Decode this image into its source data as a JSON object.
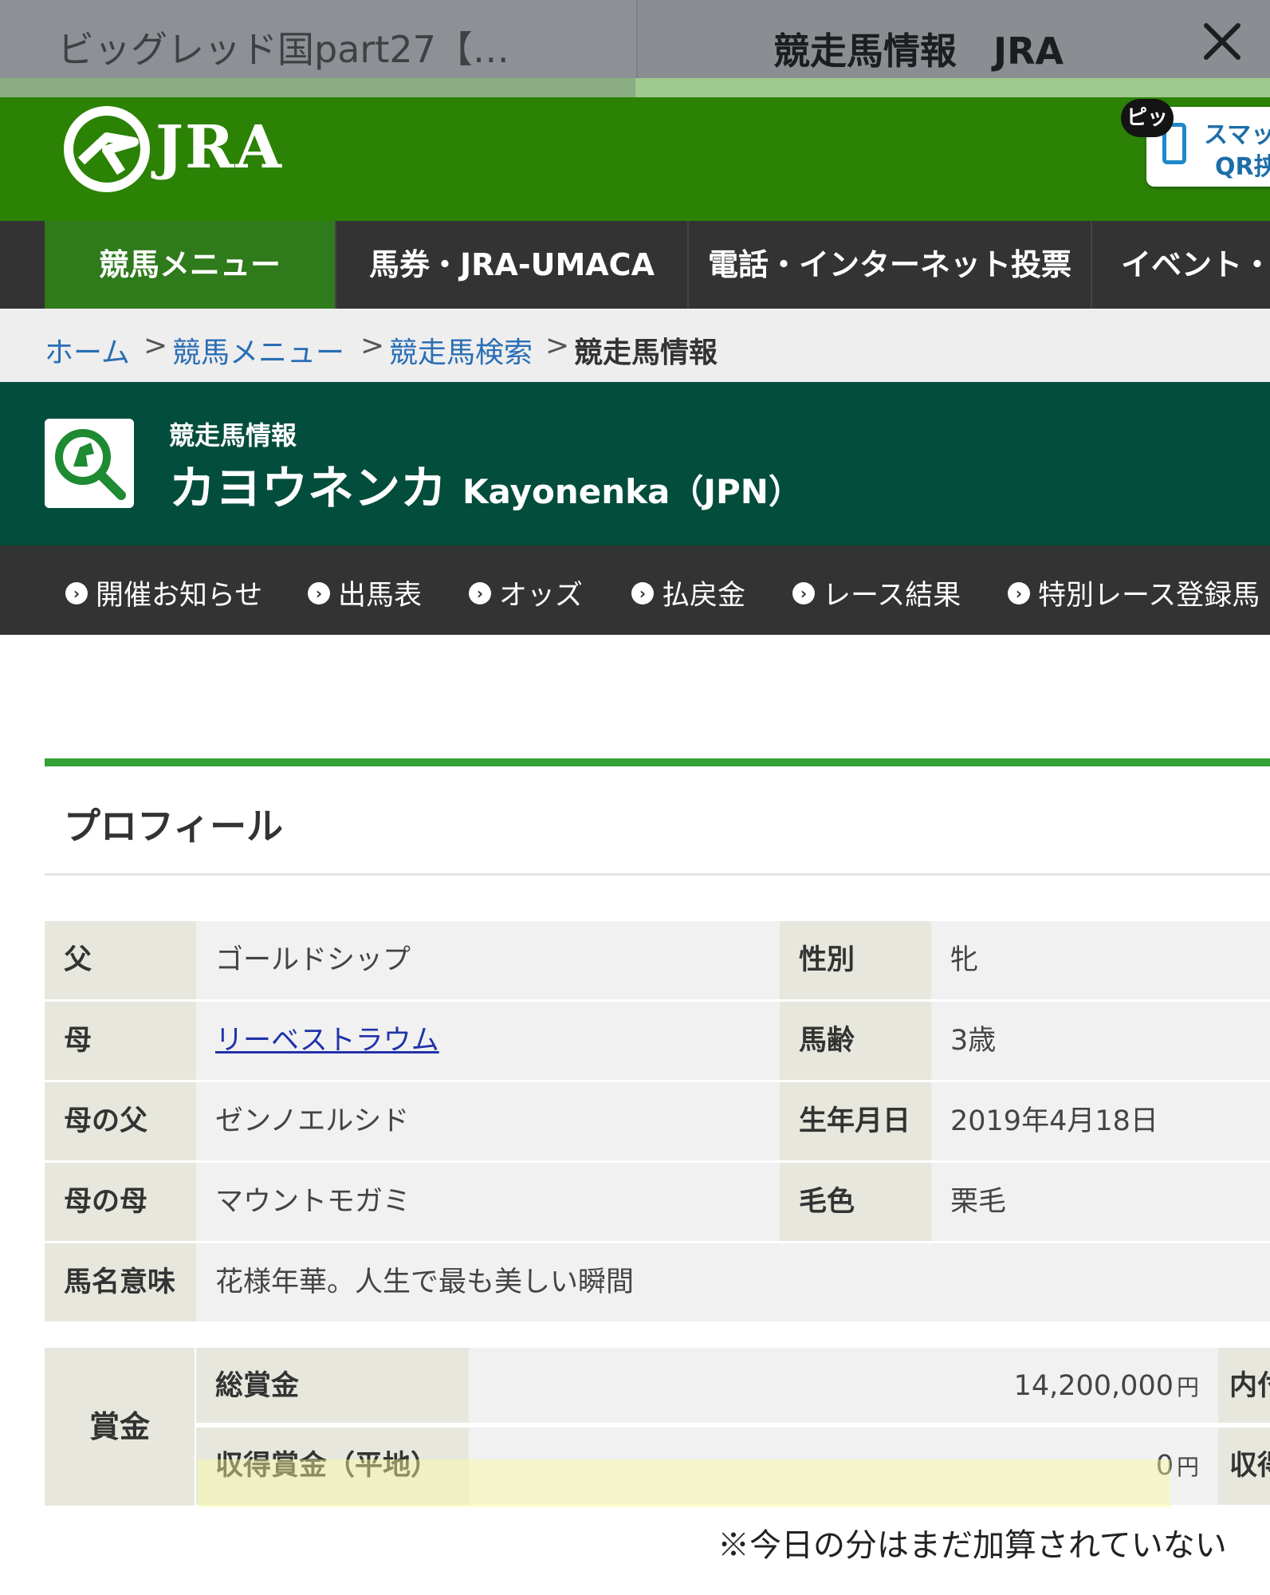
{
  "browser": {
    "left_tab_title": "ビッグレッド国part27【…",
    "active_tab_title": "競走馬情報　JRA",
    "load_progress": 0.5
  },
  "header": {
    "logo_text": "JRA",
    "qr_badge": "ピッ",
    "qr_line1": "スマッ",
    "qr_line2": "QR挟"
  },
  "main_nav": [
    "競馬メニュー",
    "馬券・JRA-UMACA",
    "電話・インターネット投票",
    "イベント・フ"
  ],
  "breadcrumb": {
    "home": "ホーム",
    "sep": ">",
    "menu": "競馬メニュー",
    "search": "競走馬検索",
    "current": "競走馬情報"
  },
  "banner": {
    "subtitle": "競走馬情報",
    "name_ja": "カヨウネンカ",
    "name_en": "Kayonenka（JPN）"
  },
  "sub_nav": [
    "開催お知らせ",
    "出馬表",
    "オッズ",
    "払戻金",
    "レース結果",
    "特別レース登録馬"
  ],
  "profile": {
    "title": "プロフィール",
    "rows": [
      {
        "l1": "父",
        "v1": "ゴールドシップ",
        "l2": "性別",
        "v2": "牝"
      },
      {
        "l1": "母",
        "v1": "リーベストラウム",
        "l2": "馬齢",
        "v2": "3歳"
      },
      {
        "l1": "母の父",
        "v1": "ゼンノエルシド",
        "l2": "生年月日",
        "v2": "2019年4月18日"
      },
      {
        "l1": "母の母",
        "v1": "マウントモガミ",
        "l2": "毛色",
        "v2": "栗毛"
      },
      {
        "l1": "馬名意味",
        "v1": "花様年華。人生で最も美しい瞬間"
      }
    ]
  },
  "prize": {
    "header": "賞金",
    "total_label": "総賞金",
    "total_value": "14,200,000",
    "earned_label": "収得賞金（平地）",
    "earned_value": "0",
    "yen": "円",
    "right1": "内付加",
    "right2": "収得賞"
  },
  "note": "※今日の分はまだ加算されていない",
  "colors": {
    "jra_green": "#2b8204",
    "banner_green": "#034d3c",
    "nav_dark": "#333333",
    "link_blue": "#2a6eb4"
  }
}
